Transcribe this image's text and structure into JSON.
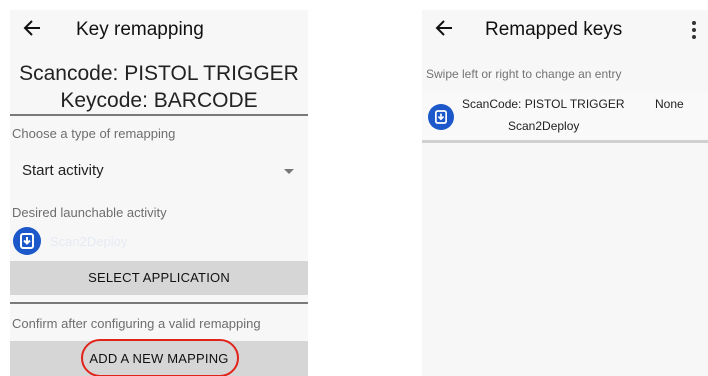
{
  "left_screen": {
    "title": "Key remapping",
    "scancode_line": "Scancode: PISTOL TRIGGER",
    "keycode_line": "Keycode: BARCODE",
    "remap_type_label": "Choose a type of remapping",
    "remap_type_value": "Start activity",
    "activity_label": "Desired launchable activity",
    "activity_app_name": "Scan2Deploy",
    "select_button": "SELECT APPLICATION",
    "confirm_label": "Confirm after configuring a valid remapping",
    "add_button": "ADD A NEW MAPPING"
  },
  "right_screen": {
    "title": "Remapped keys",
    "hint": "Swipe left or right to change an entry",
    "entries": [
      {
        "scancode": "ScanCode: PISTOL TRIGGER",
        "keycode": "None",
        "app": "Scan2Deploy"
      }
    ]
  },
  "colors": {
    "accent_icon": "#1c58c9",
    "annotation": "#e2231a",
    "button_bg": "#d6d6d6"
  },
  "icons": [
    "back-arrow-icon",
    "dropdown-caret-icon",
    "scan2deploy-app-icon",
    "overflow-menu-icon"
  ]
}
